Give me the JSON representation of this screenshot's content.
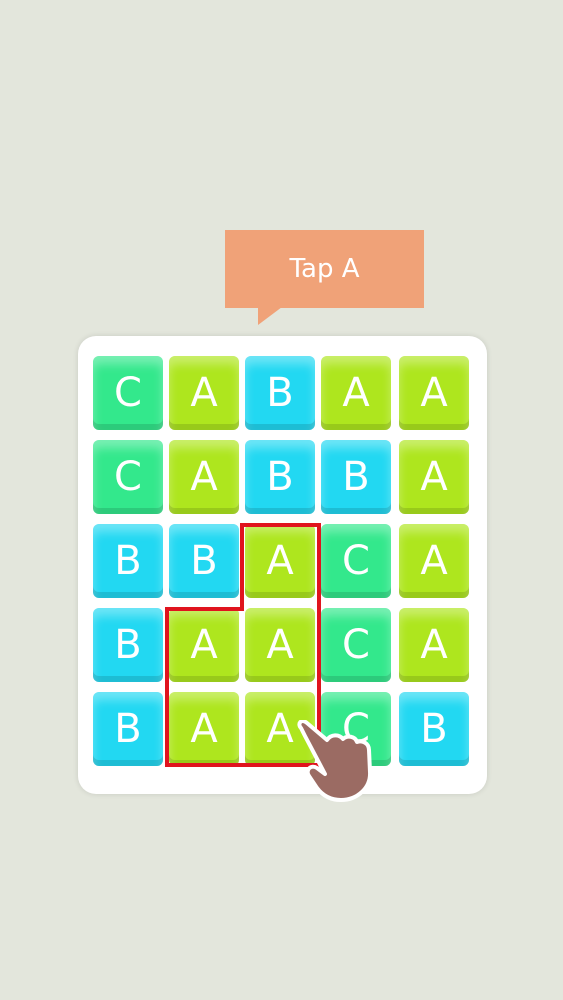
{
  "hint": {
    "text": "Tap A",
    "color": "#f0a278"
  },
  "board": {
    "rows": [
      [
        "C",
        "A",
        "B",
        "A",
        "A"
      ],
      [
        "C",
        "A",
        "B",
        "B",
        "A"
      ],
      [
        "B",
        "B",
        "A",
        "C",
        "A"
      ],
      [
        "B",
        "A",
        "A",
        "C",
        "A"
      ],
      [
        "B",
        "A",
        "A",
        "C",
        "B"
      ]
    ],
    "letter_colors": {
      "A": "#aee61e",
      "B": "#22d8f2",
      "C": "#33e88c"
    }
  },
  "selection": {
    "letter": "A",
    "cells": [
      [
        2,
        2
      ],
      [
        3,
        1
      ],
      [
        3,
        2
      ],
      [
        4,
        1
      ],
      [
        4,
        2
      ]
    ],
    "outline_color": "#e0141e"
  },
  "pointer": {
    "icon": "pointing-hand-icon",
    "target_cell": [
      4,
      2
    ]
  }
}
